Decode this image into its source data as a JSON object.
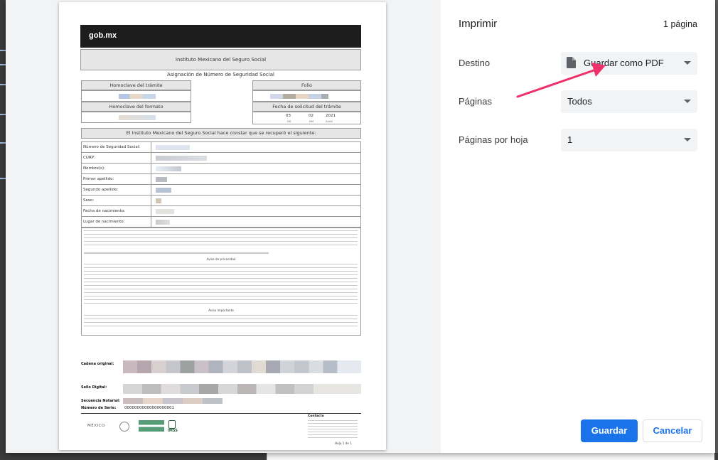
{
  "settings": {
    "title": "Imprimir",
    "page_count": "1 página",
    "destination": {
      "label": "Destino",
      "value": "Guardar como PDF"
    },
    "pages": {
      "label": "Páginas",
      "value": "Todos"
    },
    "pages_per_sheet": {
      "label": "Páginas por hoja",
      "value": "1"
    },
    "save_button": "Guardar",
    "cancel_button": "Cancelar",
    "accent_color": "#1a73e8"
  },
  "annotation": {
    "arrow_color": "#f0306a"
  },
  "document": {
    "logo": "gob.mx",
    "institute": "Instituto Mexicano del Seguro Social",
    "subtitle": "Asignación de Número de Seguridad Social",
    "homoclave_tramite": "Homoclave del trámite",
    "homoclave_formato": "Homoclave del formato",
    "folio": "Folio",
    "fecha_solicitud": "Fecha de solicitud del trámite",
    "date": {
      "day": "03",
      "month": "02",
      "year": "2021",
      "dd": "DD",
      "mm": "MM",
      "aaaa": "AAAA"
    },
    "constancia": "El Instituto Mexicano del Seguro Social hace constar que se recuperó el siguiente:",
    "fields": [
      {
        "label": "Número de Seguridad Social:"
      },
      {
        "label": "CURP:"
      },
      {
        "label": "Nombre(s):"
      },
      {
        "label": "Primer apellido:"
      },
      {
        "label": "Segundo apellido:"
      },
      {
        "label": "Sexo:"
      },
      {
        "label": "Fecha de nacimiento:"
      },
      {
        "label": "Lugar de nacimiento:"
      }
    ],
    "aviso_privacidad": "Aviso de privacidad",
    "aviso_importante": "Aviso importante",
    "cadena_original": "Cadena original:",
    "sello_digital": "Sello Digital:",
    "secuencia_notarial": "Secuencia Notarial:",
    "numero_serie": "Número de Serie:",
    "numero_serie_value": "00000000000000000001",
    "contacto": "Contacto",
    "hoja": "Hoja 1 de 1",
    "footer_mexico": "MÉXICO",
    "footer_imss": "IMSS"
  }
}
